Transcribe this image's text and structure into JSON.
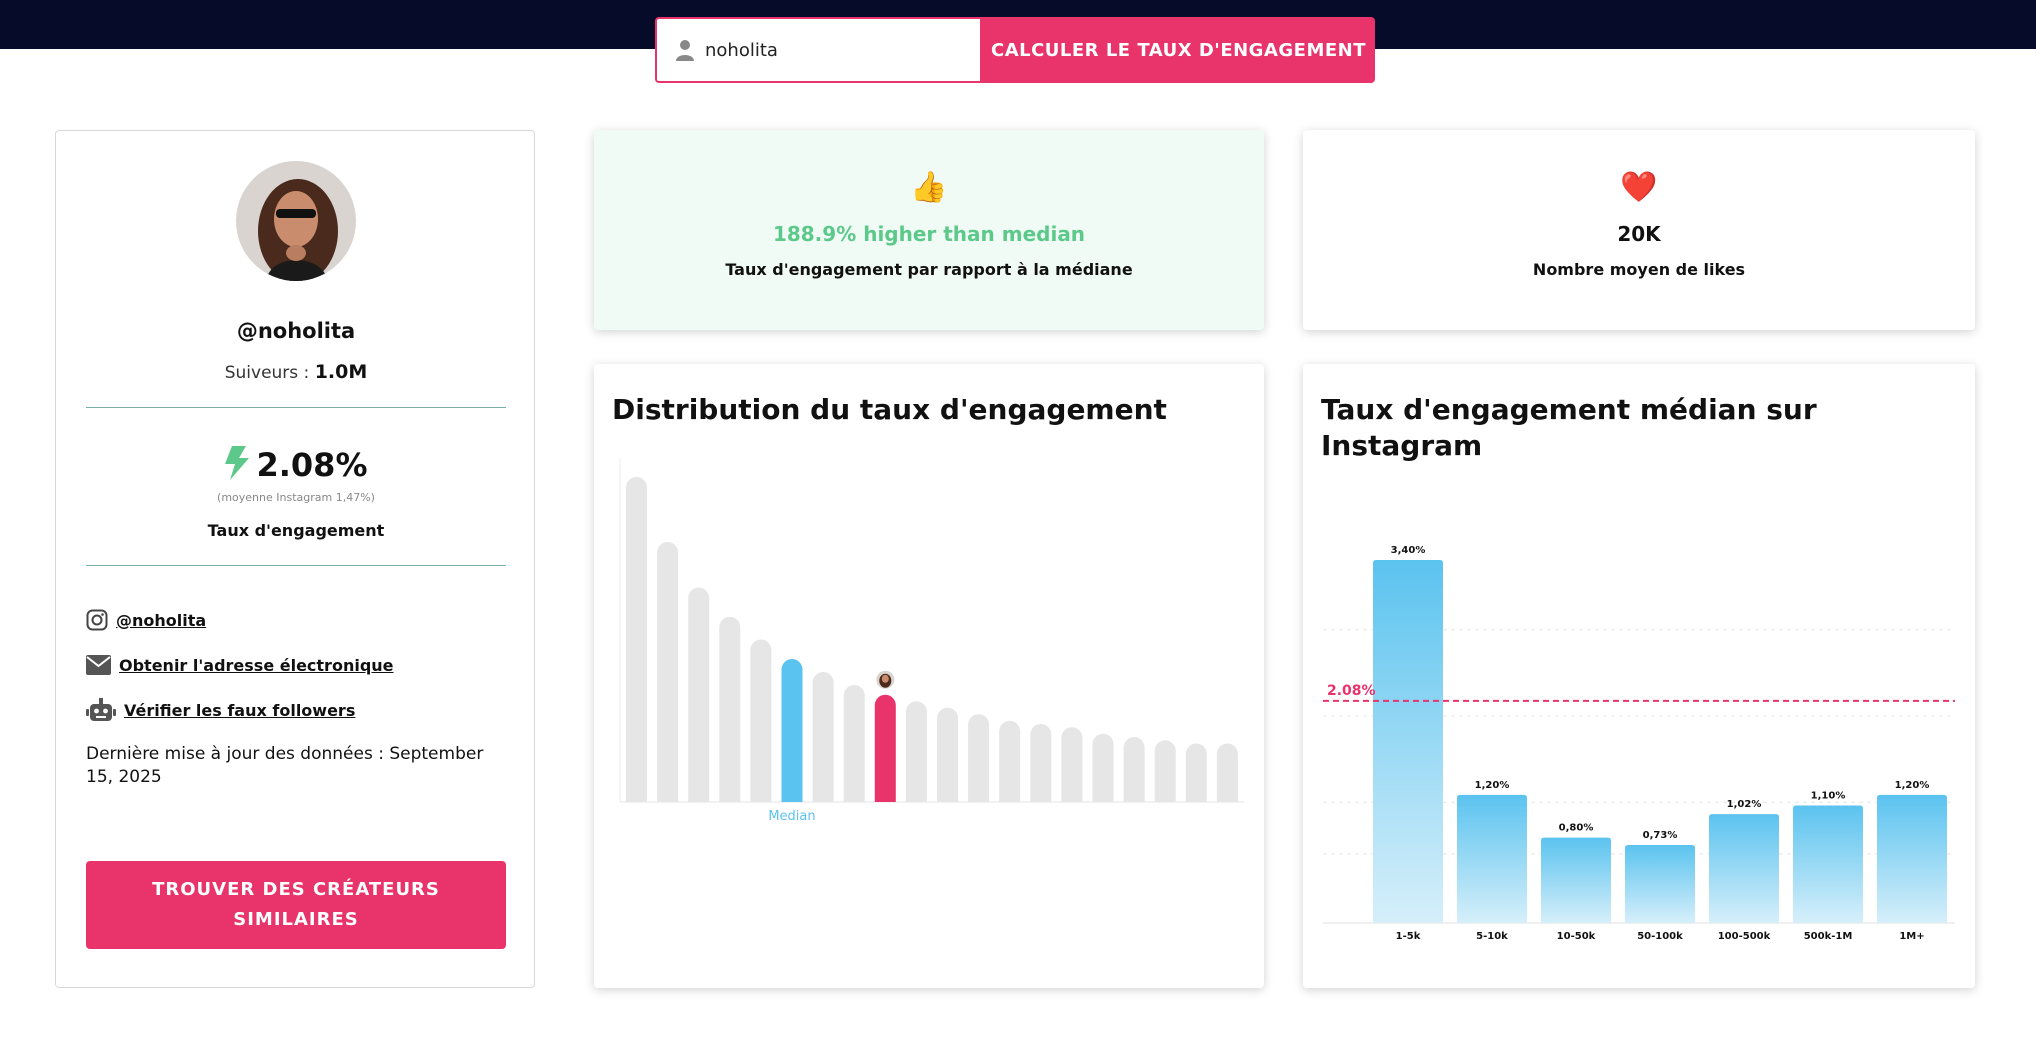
{
  "search": {
    "value": "noholita",
    "button": "CALCULER LE TAUX D'ENGAGEMENT"
  },
  "profile": {
    "handle": "@noholita",
    "followers_label": "Suiveurs :",
    "followers_value": "1.0M",
    "engagement_rate": "2.08%",
    "engagement_avg": "(moyenne Instagram 1,47%)",
    "engagement_label": "Taux d'engagement",
    "links": {
      "instagram": "@noholita",
      "email": "Obtenir l'adresse électronique",
      "fake_followers": "Vérifier les faux followers"
    },
    "updated": "Dernière mise à jour des données : September 15, 2025",
    "find_button_line1": "TROUVER DES CRÉATEURS",
    "find_button_line2": "SIMILAIRES"
  },
  "stats": {
    "median_compare": {
      "emoji": "👍",
      "headline": "188.9% higher than median",
      "label": "Taux d'engagement par rapport à la médiane",
      "color": "#5cc98a"
    },
    "likes": {
      "emoji": "❤️",
      "headline": "20K",
      "label": "Nombre moyen de likes"
    }
  },
  "colors": {
    "accent": "#e8336b",
    "navy": "#050b28",
    "blue": "#5bc3ef",
    "gray_bar": "#e6e6e6"
  },
  "chart_data": [
    {
      "type": "bar",
      "title": "Distribution du taux d'engagement",
      "annotation": "Median",
      "relative_heights": [
        1.0,
        0.8,
        0.66,
        0.57,
        0.5,
        0.44,
        0.4,
        0.36,
        0.33,
        0.31,
        0.29,
        0.27,
        0.25,
        0.24,
        0.23,
        0.21,
        0.2,
        0.19,
        0.18,
        0.18
      ],
      "median_index": 5,
      "profile_index": 8
    },
    {
      "type": "bar",
      "title": "Taux d'engagement médian sur Instagram",
      "categories": [
        "1-5k",
        "5-10k",
        "10-50k",
        "50-100k",
        "100-500k",
        "500k-1M",
        "1M+"
      ],
      "values": [
        3.4,
        1.2,
        0.8,
        0.73,
        1.02,
        1.1,
        1.2
      ],
      "value_labels": [
        "3,40%",
        "1,20%",
        "0,80%",
        "0,73%",
        "1,02%",
        "1,10%",
        "1,20%"
      ],
      "reference_line": {
        "value": 2.08,
        "label": "2.08%"
      },
      "ylim": [
        0,
        3.4
      ],
      "grid": true
    }
  ]
}
